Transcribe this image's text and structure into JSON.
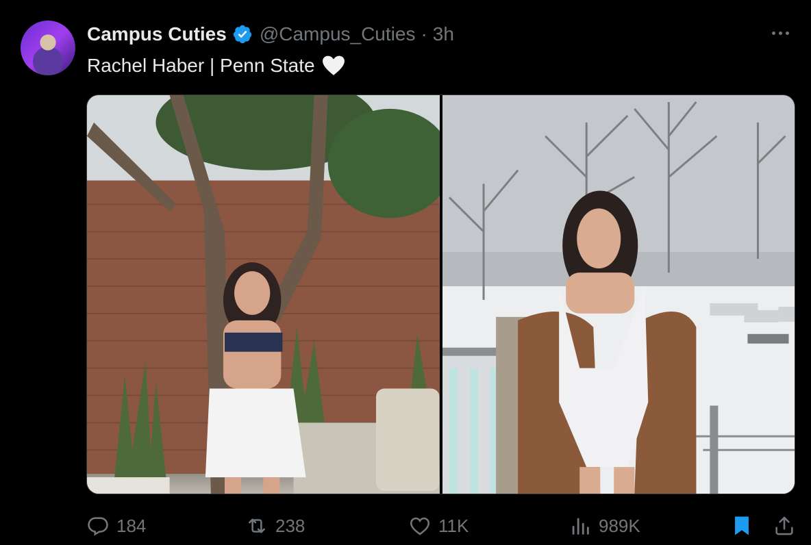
{
  "tweet": {
    "display_name": "Campus Cuties",
    "handle": "@Campus_Cuties",
    "separator": "·",
    "time": "3h",
    "text": "Rachel Haber | Penn State",
    "emoji": "white-heart"
  },
  "media": {
    "count": 2,
    "photos": [
      "photo-1",
      "photo-2"
    ]
  },
  "actions": {
    "replies": "184",
    "reposts": "238",
    "likes": "11K",
    "views": "989K"
  },
  "colors": {
    "background": "#000000",
    "text": "#e7e9ea",
    "muted": "#71767b",
    "verified": "#1d9bf0",
    "bookmark_active": "#1d9bf0"
  },
  "icons": [
    "verified-badge-icon",
    "more-icon",
    "reply-icon",
    "retweet-icon",
    "like-icon",
    "views-icon",
    "bookmark-icon",
    "share-icon"
  ]
}
